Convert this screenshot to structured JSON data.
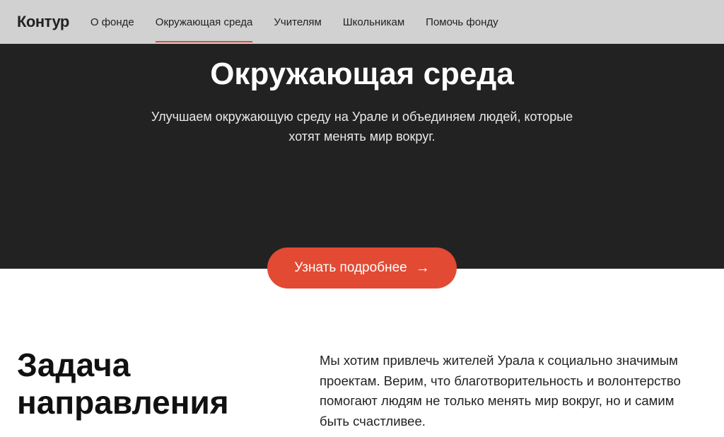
{
  "logo": "Контур",
  "nav": {
    "items": [
      {
        "label": "О фонде",
        "active": false
      },
      {
        "label": "Окружающая среда",
        "active": true
      },
      {
        "label": "Учителям",
        "active": false
      },
      {
        "label": "Школьникам",
        "active": false
      },
      {
        "label": "Помочь фонду",
        "active": false
      }
    ]
  },
  "hero": {
    "title": "Окружающая среда",
    "subtitle": "Улучшаем окружающую среду на Урале и объединяем людей, которые хотят менять мир вокруг.",
    "cta": "Узнать подробнее"
  },
  "section": {
    "title": "Задача направления",
    "body": "Мы хотим привлечь жителей Урала к социально значимым проектам. Верим, что благотворительность и волонтерство помогают людям не только менять мир вокруг, но и самим быть счастливее."
  },
  "colors": {
    "accent": "#e24a33",
    "hero_bg": "#222222",
    "nav_bg": "#d1d1d1"
  }
}
